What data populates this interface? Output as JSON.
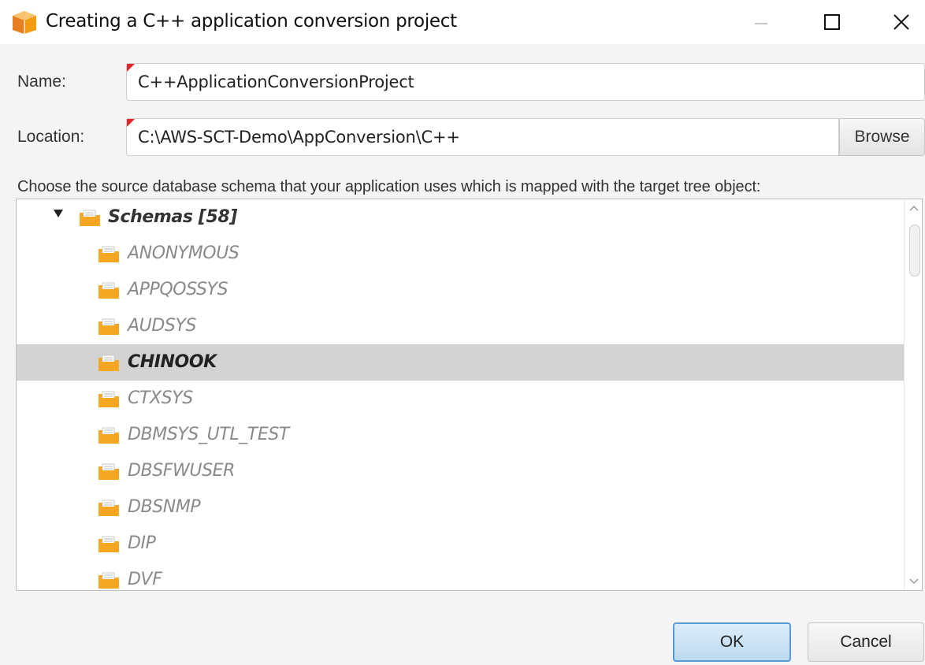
{
  "window": {
    "title": "Creating a C++ application conversion project"
  },
  "form": {
    "name_label": "Name:",
    "name_value": "C++ApplicationConversionProject",
    "location_label": "Location:",
    "location_value": "C:\\AWS-SCT-Demo\\AppConversion\\C++",
    "browse_label": "Browse",
    "instruction": "Choose the source database schema that your application uses which is mapped with the target tree object:"
  },
  "tree": {
    "root_label": "Schemas [58]",
    "items": [
      {
        "label": "ANONYMOUS"
      },
      {
        "label": "APPQOSSYS"
      },
      {
        "label": "AUDSYS"
      },
      {
        "label": "CHINOOK",
        "selected": true
      },
      {
        "label": "CTXSYS"
      },
      {
        "label": "DBMSYS_UTL_TEST"
      },
      {
        "label": "DBSFWUSER"
      },
      {
        "label": "DBSNMP"
      },
      {
        "label": "DIP"
      },
      {
        "label": "DVF"
      }
    ]
  },
  "buttons": {
    "ok_label": "OK",
    "cancel_label": "Cancel"
  },
  "icons": {
    "app": "aws-box-icon",
    "folder": "schema-folder-icon",
    "expander": "expand-arrow-icon"
  },
  "colors": {
    "folder": "#f5a623",
    "selected_row": "#d3d3d3",
    "required_marker": "#e0262b",
    "ok_border": "#5a9bd6"
  }
}
